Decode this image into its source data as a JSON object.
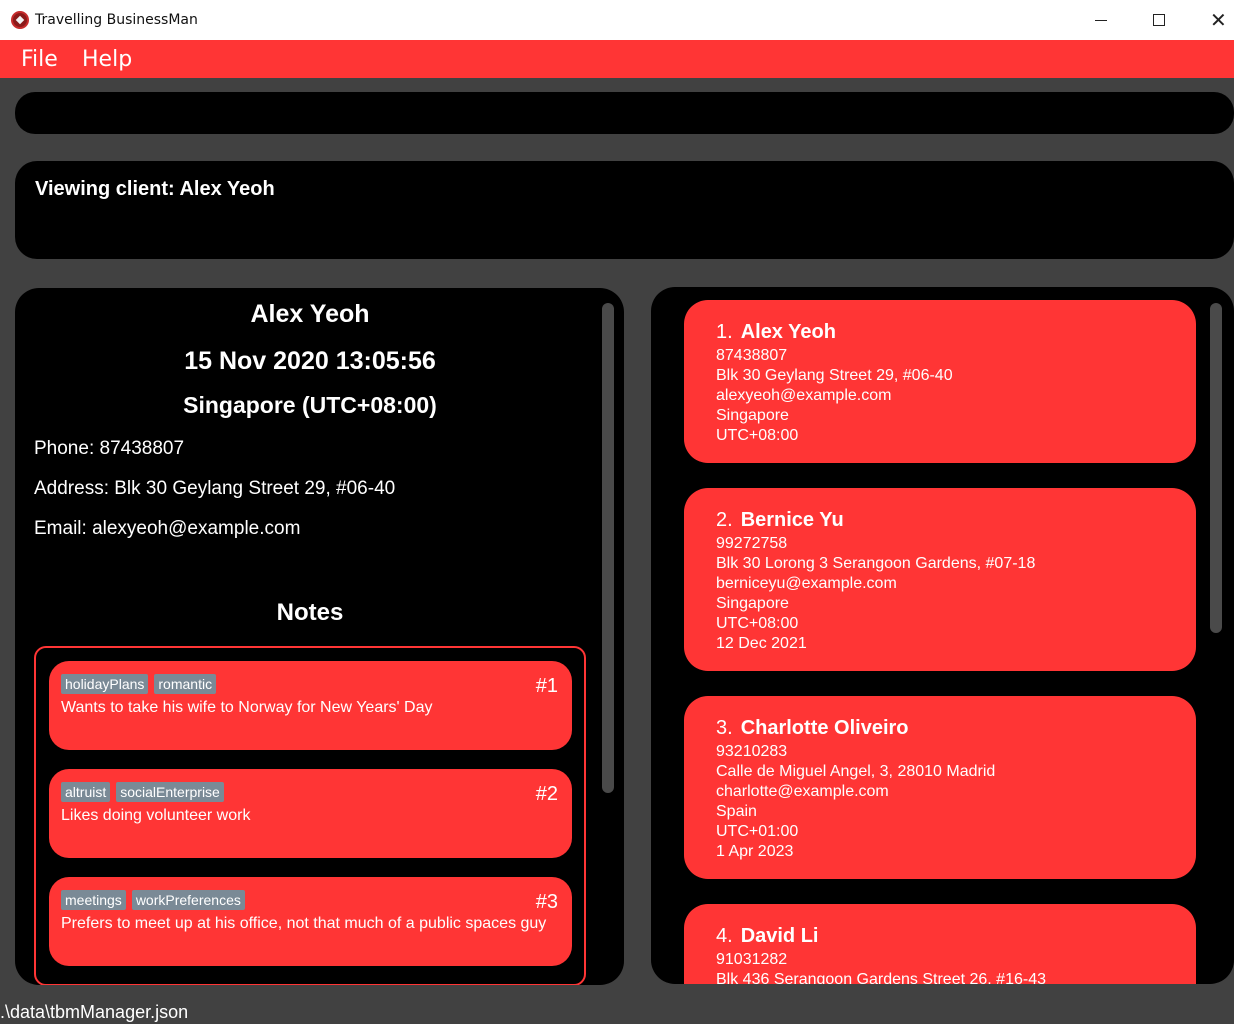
{
  "window": {
    "title": "Travelling BusinessMan"
  },
  "menu": {
    "file": "File",
    "help": "Help"
  },
  "command": {
    "value": ""
  },
  "result": {
    "text": "Viewing client: Alex Yeoh"
  },
  "detail": {
    "name": "Alex Yeoh",
    "datetime": "15 Nov 2020 13:05:56",
    "timezone": "Singapore (UTC+08:00)",
    "phone": "Phone: 87438807",
    "address": "Address: Blk 30 Geylang Street 29, #06-40",
    "email": "Email: alexyeoh@example.com",
    "notes_title": "Notes",
    "notes": [
      {
        "num": "#1",
        "tags": [
          "holidayPlans",
          "romantic"
        ],
        "text": "Wants to take his wife to Norway for New Years' Day"
      },
      {
        "num": "#2",
        "tags": [
          "altruist",
          "socialEnterprise"
        ],
        "text": "Likes doing volunteer work"
      },
      {
        "num": "#3",
        "tags": [
          "meetings",
          "workPreferences"
        ],
        "text": "Prefers to meet up at his office, not that much of a public spaces guy"
      }
    ]
  },
  "clients": [
    {
      "index": "1.",
      "name": "Alex Yeoh",
      "lines": [
        "87438807",
        "Blk 30 Geylang Street 29, #06-40",
        "alexyeoh@example.com",
        "Singapore",
        "UTC+08:00"
      ]
    },
    {
      "index": "2.",
      "name": "Bernice Yu",
      "lines": [
        "99272758",
        "Blk 30 Lorong 3 Serangoon Gardens, #07-18",
        "berniceyu@example.com",
        "Singapore",
        "UTC+08:00",
        "12 Dec 2021"
      ]
    },
    {
      "index": "3.",
      "name": "Charlotte Oliveiro",
      "lines": [
        "93210283",
        "Calle de Miguel Angel, 3, 28010 Madrid",
        "charlotte@example.com",
        "Spain",
        "UTC+01:00",
        "1 Apr 2023"
      ]
    },
    {
      "index": "4.",
      "name": "David Li",
      "lines": [
        "91031282",
        "Blk 436 Serangoon Gardens Street 26, #16-43"
      ]
    }
  ],
  "status": {
    "path": ".\\data\\tbmManager.json"
  },
  "colors": {
    "accent": "#ff3535",
    "background": "#414141",
    "panel": "#000000",
    "tag": "#7a8a96"
  }
}
